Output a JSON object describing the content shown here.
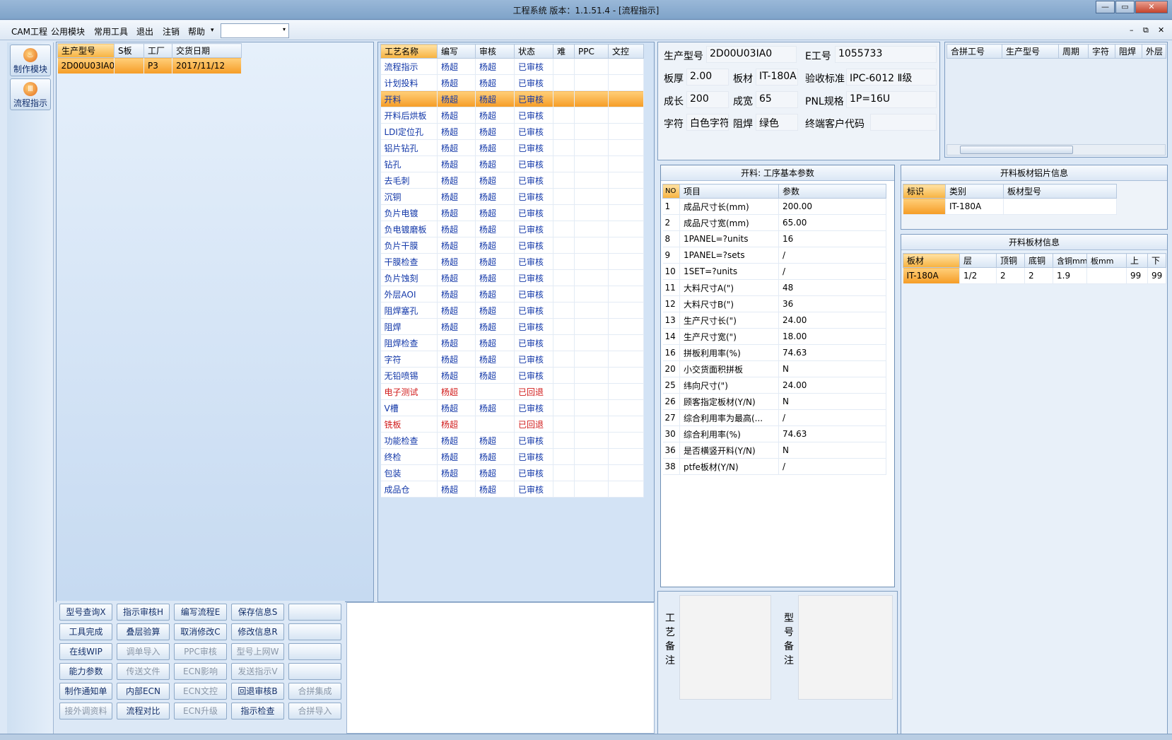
{
  "window": {
    "title": "工程系统   版本：1.1.51.4 - [流程指示]",
    "controls": {
      "minimize": "—",
      "maximize": "▭",
      "close": "✕"
    }
  },
  "menu": {
    "items": [
      "CAM工程",
      "公用模块",
      "常用工具",
      "退出",
      "注销",
      "帮助"
    ],
    "help_arrow": "▾",
    "combo_value": "",
    "combo_arrow": "▾",
    "mdi_controls": [
      "–",
      "⧉",
      "✕"
    ]
  },
  "sidebar": {
    "items": [
      {
        "label": "制作模块",
        "icon": "fire-icon"
      },
      {
        "label": "流程指示",
        "icon": "flow-icon"
      }
    ]
  },
  "orders": {
    "columns": [
      "生产型号",
      "S板",
      "工厂",
      "交货日期"
    ],
    "rows": [
      {
        "model": "2D00U03IA0",
        "s": "",
        "factory": "P3",
        "date": "2017/11/12"
      }
    ]
  },
  "process": {
    "columns": [
      "工艺名称",
      "编写",
      "审核",
      "状态",
      "难",
      "PPC",
      "文控"
    ],
    "selected_index": 2,
    "rows": [
      {
        "name": "流程指示",
        "writer": "杨超",
        "reviewer": "杨超",
        "status": "已审核",
        "red": false
      },
      {
        "name": "计划投料",
        "writer": "杨超",
        "reviewer": "杨超",
        "status": "已审核",
        "red": false
      },
      {
        "name": "开料",
        "writer": "杨超",
        "reviewer": "杨超",
        "status": "已审核",
        "red": false
      },
      {
        "name": "开料后烘板",
        "writer": "杨超",
        "reviewer": "杨超",
        "status": "已审核",
        "red": false
      },
      {
        "name": "LDI定位孔",
        "writer": "杨超",
        "reviewer": "杨超",
        "status": "已审核",
        "red": false
      },
      {
        "name": "铝片钻孔",
        "writer": "杨超",
        "reviewer": "杨超",
        "status": "已审核",
        "red": false
      },
      {
        "name": "钻孔",
        "writer": "杨超",
        "reviewer": "杨超",
        "status": "已审核",
        "red": false
      },
      {
        "name": "去毛刺",
        "writer": "杨超",
        "reviewer": "杨超",
        "status": "已审核",
        "red": false
      },
      {
        "name": "沉铜",
        "writer": "杨超",
        "reviewer": "杨超",
        "status": "已审核",
        "red": false
      },
      {
        "name": "负片电镀",
        "writer": "杨超",
        "reviewer": "杨超",
        "status": "已审核",
        "red": false
      },
      {
        "name": "负电镀磨板",
        "writer": "杨超",
        "reviewer": "杨超",
        "status": "已审核",
        "red": false
      },
      {
        "name": "负片干膜",
        "writer": "杨超",
        "reviewer": "杨超",
        "status": "已审核",
        "red": false
      },
      {
        "name": "干膜检查",
        "writer": "杨超",
        "reviewer": "杨超",
        "status": "已审核",
        "red": false
      },
      {
        "name": "负片蚀刻",
        "writer": "杨超",
        "reviewer": "杨超",
        "status": "已审核",
        "red": false
      },
      {
        "name": "外层AOI",
        "writer": "杨超",
        "reviewer": "杨超",
        "status": "已审核",
        "red": false
      },
      {
        "name": "阻焊塞孔",
        "writer": "杨超",
        "reviewer": "杨超",
        "status": "已审核",
        "red": false
      },
      {
        "name": "阻焊",
        "writer": "杨超",
        "reviewer": "杨超",
        "status": "已审核",
        "red": false
      },
      {
        "name": "阻焊检查",
        "writer": "杨超",
        "reviewer": "杨超",
        "status": "已审核",
        "red": false
      },
      {
        "name": "字符",
        "writer": "杨超",
        "reviewer": "杨超",
        "status": "已审核",
        "red": false
      },
      {
        "name": "无铅喷锡",
        "writer": "杨超",
        "reviewer": "杨超",
        "status": "已审核",
        "red": false
      },
      {
        "name": "电子测试",
        "writer": "杨超",
        "reviewer": "",
        "status": "已回退",
        "red": true
      },
      {
        "name": "V槽",
        "writer": "杨超",
        "reviewer": "杨超",
        "status": "已审核",
        "red": false
      },
      {
        "name": "铣板",
        "writer": "杨超",
        "reviewer": "",
        "status": "已回退",
        "red": true
      },
      {
        "name": "功能检查",
        "writer": "杨超",
        "reviewer": "杨超",
        "status": "已审核",
        "red": false
      },
      {
        "name": "终检",
        "writer": "杨超",
        "reviewer": "杨超",
        "status": "已审核",
        "red": false
      },
      {
        "name": "包装",
        "writer": "杨超",
        "reviewer": "杨超",
        "status": "已审核",
        "red": false
      },
      {
        "name": "成品仓",
        "writer": "杨超",
        "reviewer": "杨超",
        "status": "已审核",
        "red": false
      }
    ]
  },
  "info": {
    "model_label": "生产型号",
    "model": "2D00U03IA0",
    "eno_label": "E工号",
    "eno": "1055733",
    "thickness_label": "板厚",
    "thickness": "2.00",
    "material_label": "板材",
    "material": "IT-180A",
    "standard_label": "验收标准",
    "standard": "IPC-6012 Ⅱ级",
    "length_label": "成长",
    "length": "200",
    "width_label": "成宽",
    "width": "65",
    "pnl_label": "PNL规格",
    "pnl": "1P=16U",
    "char_label": "字符",
    "char": "白色字符",
    "mask_label": "阻焊",
    "mask": "绿色",
    "customer_label": "终端客户代码",
    "customer": ""
  },
  "merge": {
    "columns": [
      "合拼工号",
      "生产型号",
      "周期",
      "字符",
      "阻焊",
      "外层"
    ]
  },
  "params": {
    "title": "开料: 工序基本参数",
    "columns": [
      "NO",
      "项目",
      "参数"
    ],
    "rows": [
      {
        "no": "1",
        "item": "成品尺寸长(mm)",
        "value": "200.00"
      },
      {
        "no": "2",
        "item": "成品尺寸宽(mm)",
        "value": "65.00"
      },
      {
        "no": "8",
        "item": "1PANEL=?units",
        "value": "16"
      },
      {
        "no": "9",
        "item": "1PANEL=?sets",
        "value": "/"
      },
      {
        "no": "10",
        "item": "1SET=?units",
        "value": "/"
      },
      {
        "no": "11",
        "item": "大料尺寸A(\")",
        "value": "48"
      },
      {
        "no": "12",
        "item": "大料尺寸B(\")",
        "value": "36"
      },
      {
        "no": "13",
        "item": "生产尺寸长(\")",
        "value": "24.00"
      },
      {
        "no": "14",
        "item": "生产尺寸宽(\")",
        "value": "18.00"
      },
      {
        "no": "16",
        "item": "拼板利用率(%)",
        "value": "74.63"
      },
      {
        "no": "20",
        "item": "小交货面积拼板",
        "value": "N"
      },
      {
        "no": "25",
        "item": "纬向尺寸(\")",
        "value": "24.00"
      },
      {
        "no": "26",
        "item": "顾客指定板材(Y/N)",
        "value": "N"
      },
      {
        "no": "27",
        "item": "综合利用率为最高(...",
        "value": "/"
      },
      {
        "no": "30",
        "item": "综合利用率(%)",
        "value": "74.63"
      },
      {
        "no": "36",
        "item": "是否横竖开料(Y/N)",
        "value": "N"
      },
      {
        "no": "38",
        "item": "ptfe板材(Y/N)",
        "value": "/"
      }
    ]
  },
  "aluminum": {
    "title": "开料板材铝片信息",
    "columns": [
      "标识",
      "类别",
      "板材型号"
    ],
    "rows": [
      {
        "tag": "",
        "type": "IT-180A",
        "model": ""
      }
    ]
  },
  "board": {
    "title": "开料板材信息",
    "columns": [
      "板材",
      "层",
      "顶铜",
      "底铜",
      "含铜mm",
      "板mm",
      "上",
      "下"
    ],
    "rows": [
      {
        "material": "IT-180A",
        "layer": "1/2",
        "top": "2",
        "bottom": "2",
        "cu": "1.9",
        "board": "",
        "up": "99",
        "down": "99"
      }
    ]
  },
  "notes": {
    "process_label": [
      "工",
      "艺",
      "备",
      "注"
    ],
    "model_label": [
      "型",
      "号",
      "备",
      "注"
    ]
  },
  "buttons": {
    "rows": [
      [
        {
          "t": "型号查询X",
          "d": false
        },
        {
          "t": "指示审核H",
          "d": false
        },
        {
          "t": "编写流程E",
          "d": false
        },
        {
          "t": "保存信息S",
          "d": false
        },
        {
          "t": "",
          "d": false
        }
      ],
      [
        {
          "t": "工具完成",
          "d": false
        },
        {
          "t": "叠层验算",
          "d": false
        },
        {
          "t": "取消修改C",
          "d": false
        },
        {
          "t": "修改信息R",
          "d": false
        },
        {
          "t": "",
          "d": false
        }
      ],
      [
        {
          "t": "在线WIP",
          "d": false
        },
        {
          "t": "调单导入",
          "d": true
        },
        {
          "t": "PPC审核",
          "d": true
        },
        {
          "t": "型号上网W",
          "d": true
        },
        {
          "t": "",
          "d": false
        }
      ],
      [
        {
          "t": "能力参数",
          "d": false
        },
        {
          "t": "传送文件",
          "d": true
        },
        {
          "t": "ECN影响",
          "d": true
        },
        {
          "t": "发送指示V",
          "d": true
        },
        {
          "t": "",
          "d": false
        }
      ],
      [
        {
          "t": "制作通知单",
          "d": false
        },
        {
          "t": "内部ECN",
          "d": false
        },
        {
          "t": "ECN文控",
          "d": true
        },
        {
          "t": "回退审核B",
          "d": false
        },
        {
          "t": "合拼集成",
          "d": true
        }
      ],
      [
        {
          "t": "接外调资料",
          "d": true
        },
        {
          "t": "流程对比",
          "d": false
        },
        {
          "t": "ECN升级",
          "d": true
        },
        {
          "t": "指示检查",
          "d": false
        },
        {
          "t": "合拼导入",
          "d": true
        }
      ]
    ]
  }
}
